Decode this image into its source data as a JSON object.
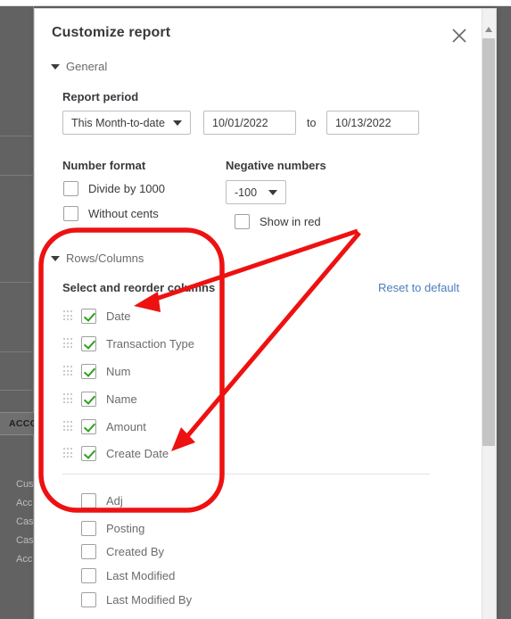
{
  "background": {
    "table_header": "ACCO",
    "rows": [
      "Cus",
      "Acc",
      "Cas",
      "Cas",
      "Acc"
    ]
  },
  "modal": {
    "title": "Customize report",
    "close_icon": "close-icon",
    "scrollbar": {
      "up_icon": "scroll-up-arrow-icon"
    },
    "general": {
      "section_label": "General",
      "report_period_label": "Report period",
      "period_select_value": "This Month-to-date",
      "date_from": "10/01/2022",
      "to_label": "to",
      "date_to": "10/13/2022",
      "number_format_label": "Number format",
      "divide_by_1000_label": "Divide by 1000",
      "divide_by_1000_checked": false,
      "without_cents_label": "Without cents",
      "without_cents_checked": false,
      "negative_numbers_label": "Negative numbers",
      "negative_format_value": "-100",
      "show_in_red_label": "Show in red",
      "show_in_red_checked": false
    },
    "rows_columns": {
      "section_label": "Rows/Columns",
      "select_reorder_label": "Select and reorder columns",
      "reset_link": "Reset to default",
      "selected_columns": [
        {
          "label": "Date",
          "checked": true
        },
        {
          "label": "Transaction Type",
          "checked": true
        },
        {
          "label": "Num",
          "checked": true
        },
        {
          "label": "Name",
          "checked": true
        },
        {
          "label": "Amount",
          "checked": true
        },
        {
          "label": "Create Date",
          "checked": true
        }
      ],
      "available_columns": [
        {
          "label": "Adj",
          "checked": false
        },
        {
          "label": "Posting",
          "checked": false
        },
        {
          "label": "Created By",
          "checked": false
        },
        {
          "label": "Last Modified",
          "checked": false
        },
        {
          "label": "Last Modified By",
          "checked": false
        }
      ]
    }
  },
  "annotation": {
    "color": "#ee1c१c",
    "highlight_color": "#ee1111",
    "shapes": [
      "rounded-rect-highlight",
      "arrow-to-date",
      "arrow-to-create-date"
    ]
  }
}
